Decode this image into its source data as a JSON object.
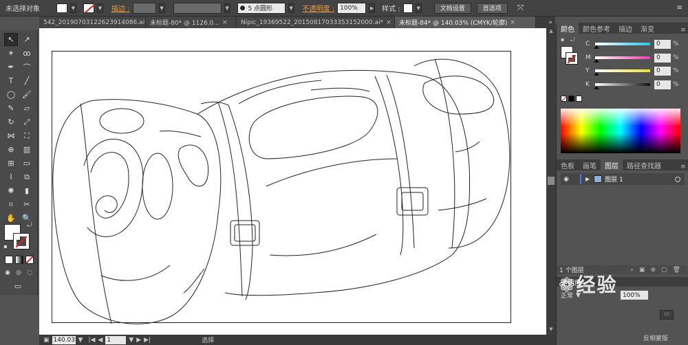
{
  "control_bar": {
    "selection_status": "未选择对象",
    "stroke_label": "描边 :",
    "brush_label": "5 点圆形",
    "opacity_label": "不透明度 :",
    "opacity_value": "100%",
    "style_label": "样式 :",
    "doc_settings_button": "文档设置",
    "preferences_button": "首选项"
  },
  "tabs": [
    {
      "label": "542_20190703122623914086.ai*",
      "active": false
    },
    {
      "label": "未标题-80* @ 1126.0...",
      "active": false
    },
    {
      "label": "Nipic_19369522_20150817033353152000.ai*",
      "active": false
    },
    {
      "label": "未标题-84* @ 140.03% (CMYK/轮廓)",
      "active": true
    }
  ],
  "status_bar": {
    "zoom": "140.03",
    "page": "1",
    "mode": "选择"
  },
  "color_panel": {
    "tabs": [
      "颜色",
      "颜色参考",
      "描边",
      "渐变"
    ],
    "channels": [
      {
        "label": "C",
        "value": "0",
        "unit": "%"
      },
      {
        "label": "M",
        "value": "0",
        "unit": "%"
      },
      {
        "label": "Y",
        "value": "0",
        "unit": "%"
      },
      {
        "label": "K",
        "value": "0",
        "unit": "%"
      }
    ],
    "channel_colors": [
      "#29c4e8",
      "#e83fa8",
      "#ece22b",
      "#111111"
    ]
  },
  "layers_panel": {
    "tabs": [
      "色板",
      "画笔",
      "图层",
      "路径查找器"
    ],
    "layer_name": "图层 1",
    "footer": "1 个图层"
  },
  "transparency_panel": {
    "title": "透明度",
    "mode": "正常",
    "opacity": "100%",
    "footer_text": "反相蒙版"
  },
  "watermark": "经验"
}
